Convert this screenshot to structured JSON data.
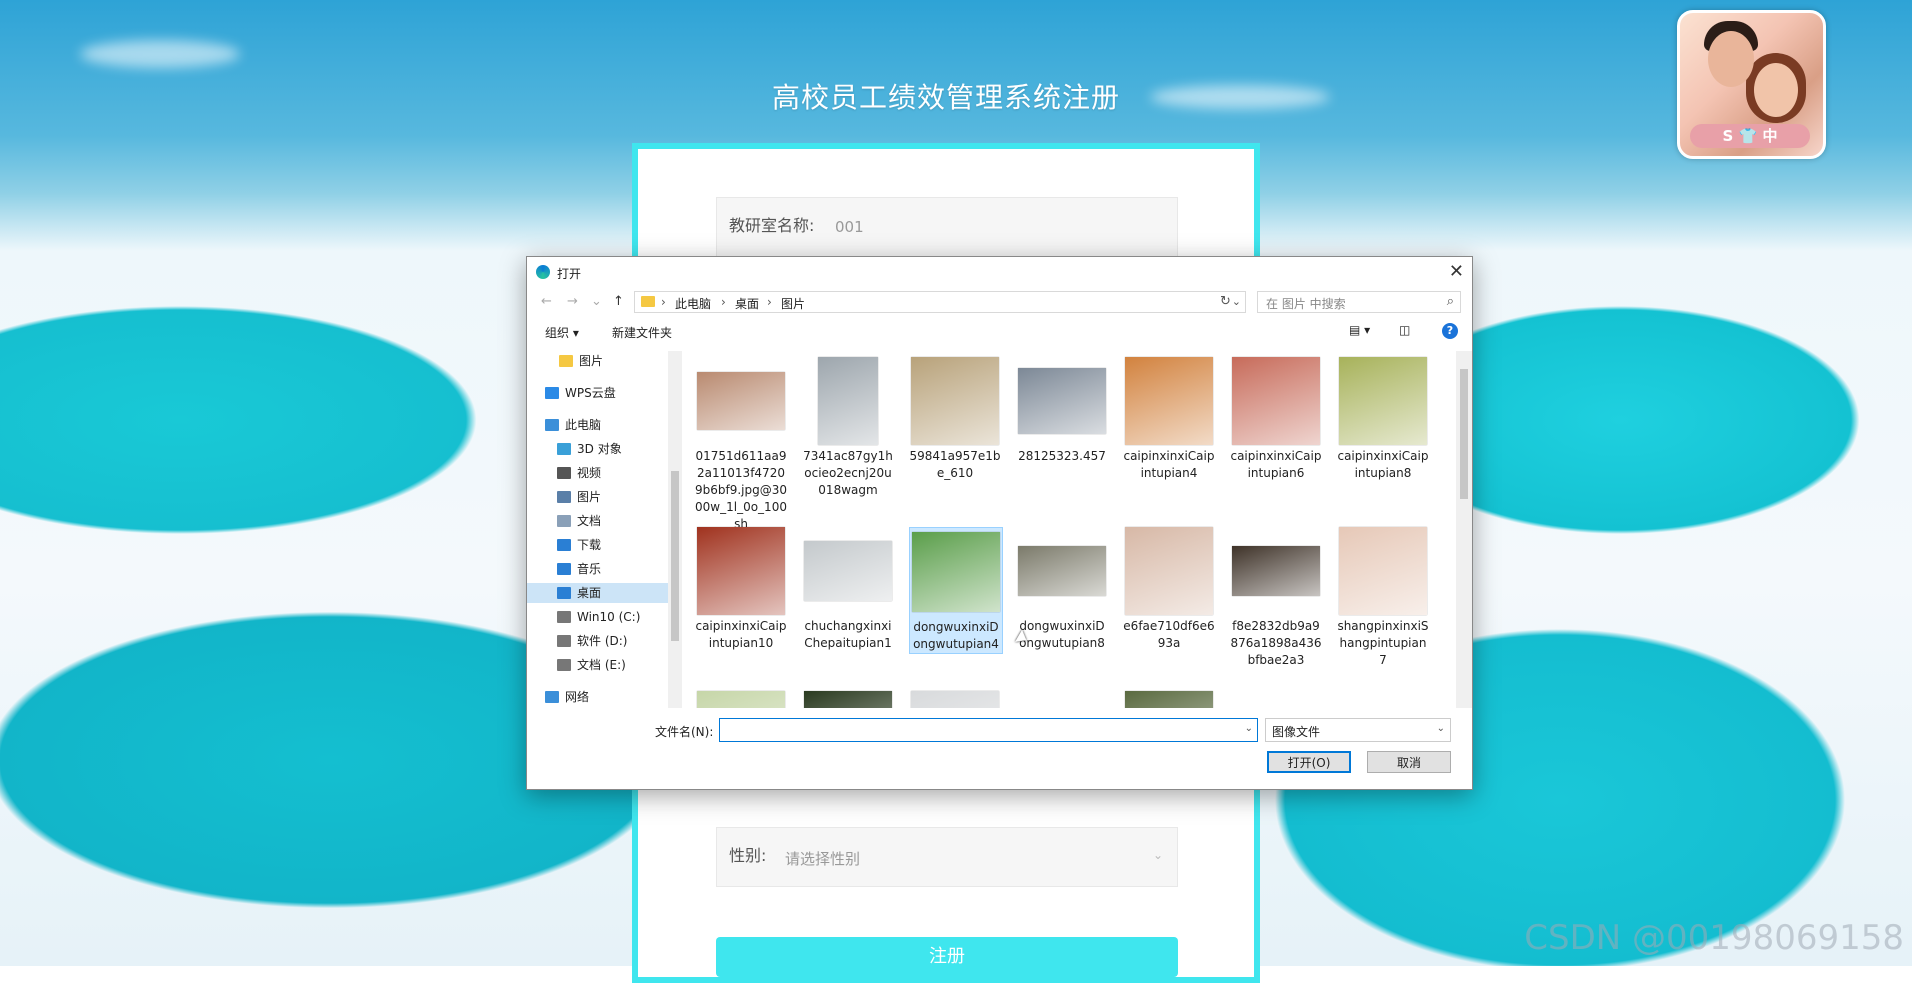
{
  "page": {
    "title": "高校员工绩效管理系统注册",
    "watermark": "CSDN @00198069158"
  },
  "form": {
    "department_label": "教研室名称:",
    "department_value": "001",
    "gender_label": "性别:",
    "gender_placeholder": "请选择性别",
    "register_button": "注册"
  },
  "avatar": {
    "badge_text": "S 👕 中"
  },
  "dialog": {
    "title": "打开",
    "close": "✕",
    "nav": {
      "back": "←",
      "forward": "→",
      "recent": "⌄",
      "up": "↑"
    },
    "breadcrumb": [
      "此电脑",
      "桌面",
      "图片"
    ],
    "refresh": "↻",
    "search_placeholder": "在 图片 中搜索",
    "toolbar": {
      "organize": "组织 ▾",
      "new_folder": "新建文件夹",
      "help": "?"
    },
    "nav_pane": [
      {
        "label": "图片",
        "icon": "folder-icon",
        "color": "#f5c842"
      },
      {
        "label": "WPS云盘",
        "icon": "cloud-icon",
        "color": "#2b8ae6"
      },
      {
        "label": "此电脑",
        "icon": "computer-icon",
        "color": "#3b8fd9"
      },
      {
        "label": "3D 对象",
        "icon": "cube-icon",
        "color": "#3aa0d8"
      },
      {
        "label": "视频",
        "icon": "video-icon",
        "color": "#555555"
      },
      {
        "label": "图片",
        "icon": "pictures-icon",
        "color": "#5a7fa8"
      },
      {
        "label": "文档",
        "icon": "document-icon",
        "color": "#8aa0b8"
      },
      {
        "label": "下载",
        "icon": "download-icon",
        "color": "#2a7fd4"
      },
      {
        "label": "音乐",
        "icon": "music-icon",
        "color": "#2a7fd4"
      },
      {
        "label": "桌面",
        "icon": "desktop-icon",
        "color": "#2a7fd4",
        "selected": true
      },
      {
        "label": "Win10 (C:)",
        "icon": "drive-icon",
        "color": "#777777"
      },
      {
        "label": "软件 (D:)",
        "icon": "drive-icon",
        "color": "#777777"
      },
      {
        "label": "文档 (E:)",
        "icon": "drive-icon",
        "color": "#777777"
      },
      {
        "label": "网络",
        "icon": "network-icon",
        "color": "#3b8fd9"
      }
    ],
    "files": [
      {
        "name": "01751d611aa92a11013f47209b6bf9.jpg@3000w_1l_0o_100sh",
        "color": "#b98a70"
      },
      {
        "name": "7341ac87gy1hocieo2ecnj20u018wagm",
        "color": "#9da6ad"
      },
      {
        "name": "59841a957e1be_610",
        "color": "#b8a27a"
      },
      {
        "name": "28125323.457",
        "color": "#7c8896"
      },
      {
        "name": "caipinxinxiCaipintupian4",
        "color": "#d2823e"
      },
      {
        "name": "caipinxinxiCaipintupian6",
        "color": "#c76b5a"
      },
      {
        "name": "caipinxinxiCaipintupian8",
        "color": "#a7b25a"
      },
      {
        "name": "caipinxinxiCaipintupian10",
        "color": "#a0321e"
      },
      {
        "name": "chuchangxinxiChepaitupian1",
        "color": "#c4c9cc"
      },
      {
        "name": "dongwuxinxiDongwutupian4",
        "color": "#5a9e4a",
        "selected": true
      },
      {
        "name": "dongwuxinxiDongwutupian8",
        "color": "#7b7a6a"
      },
      {
        "name": "e6fae710df6e693a",
        "color": "#d7b8a6"
      },
      {
        "name": "f8e2832db9a9876a1898a436bfbae2a3",
        "color": "#3e3228"
      },
      {
        "name": "shangpinxinxiShangpintupian7",
        "color": "#e6c8b7"
      },
      {
        "name": "",
        "color": "#c6d6a8"
      },
      {
        "name": "",
        "color": "#2a3a20"
      },
      {
        "name": "",
        "color": "#d8dadc"
      },
      {
        "name": "",
        "color": "#5a6a40"
      }
    ],
    "filename_label": "文件名(N):",
    "filename_value": "",
    "filetype": "图像文件",
    "open_button": "打开(O)",
    "cancel_button": "取消"
  }
}
